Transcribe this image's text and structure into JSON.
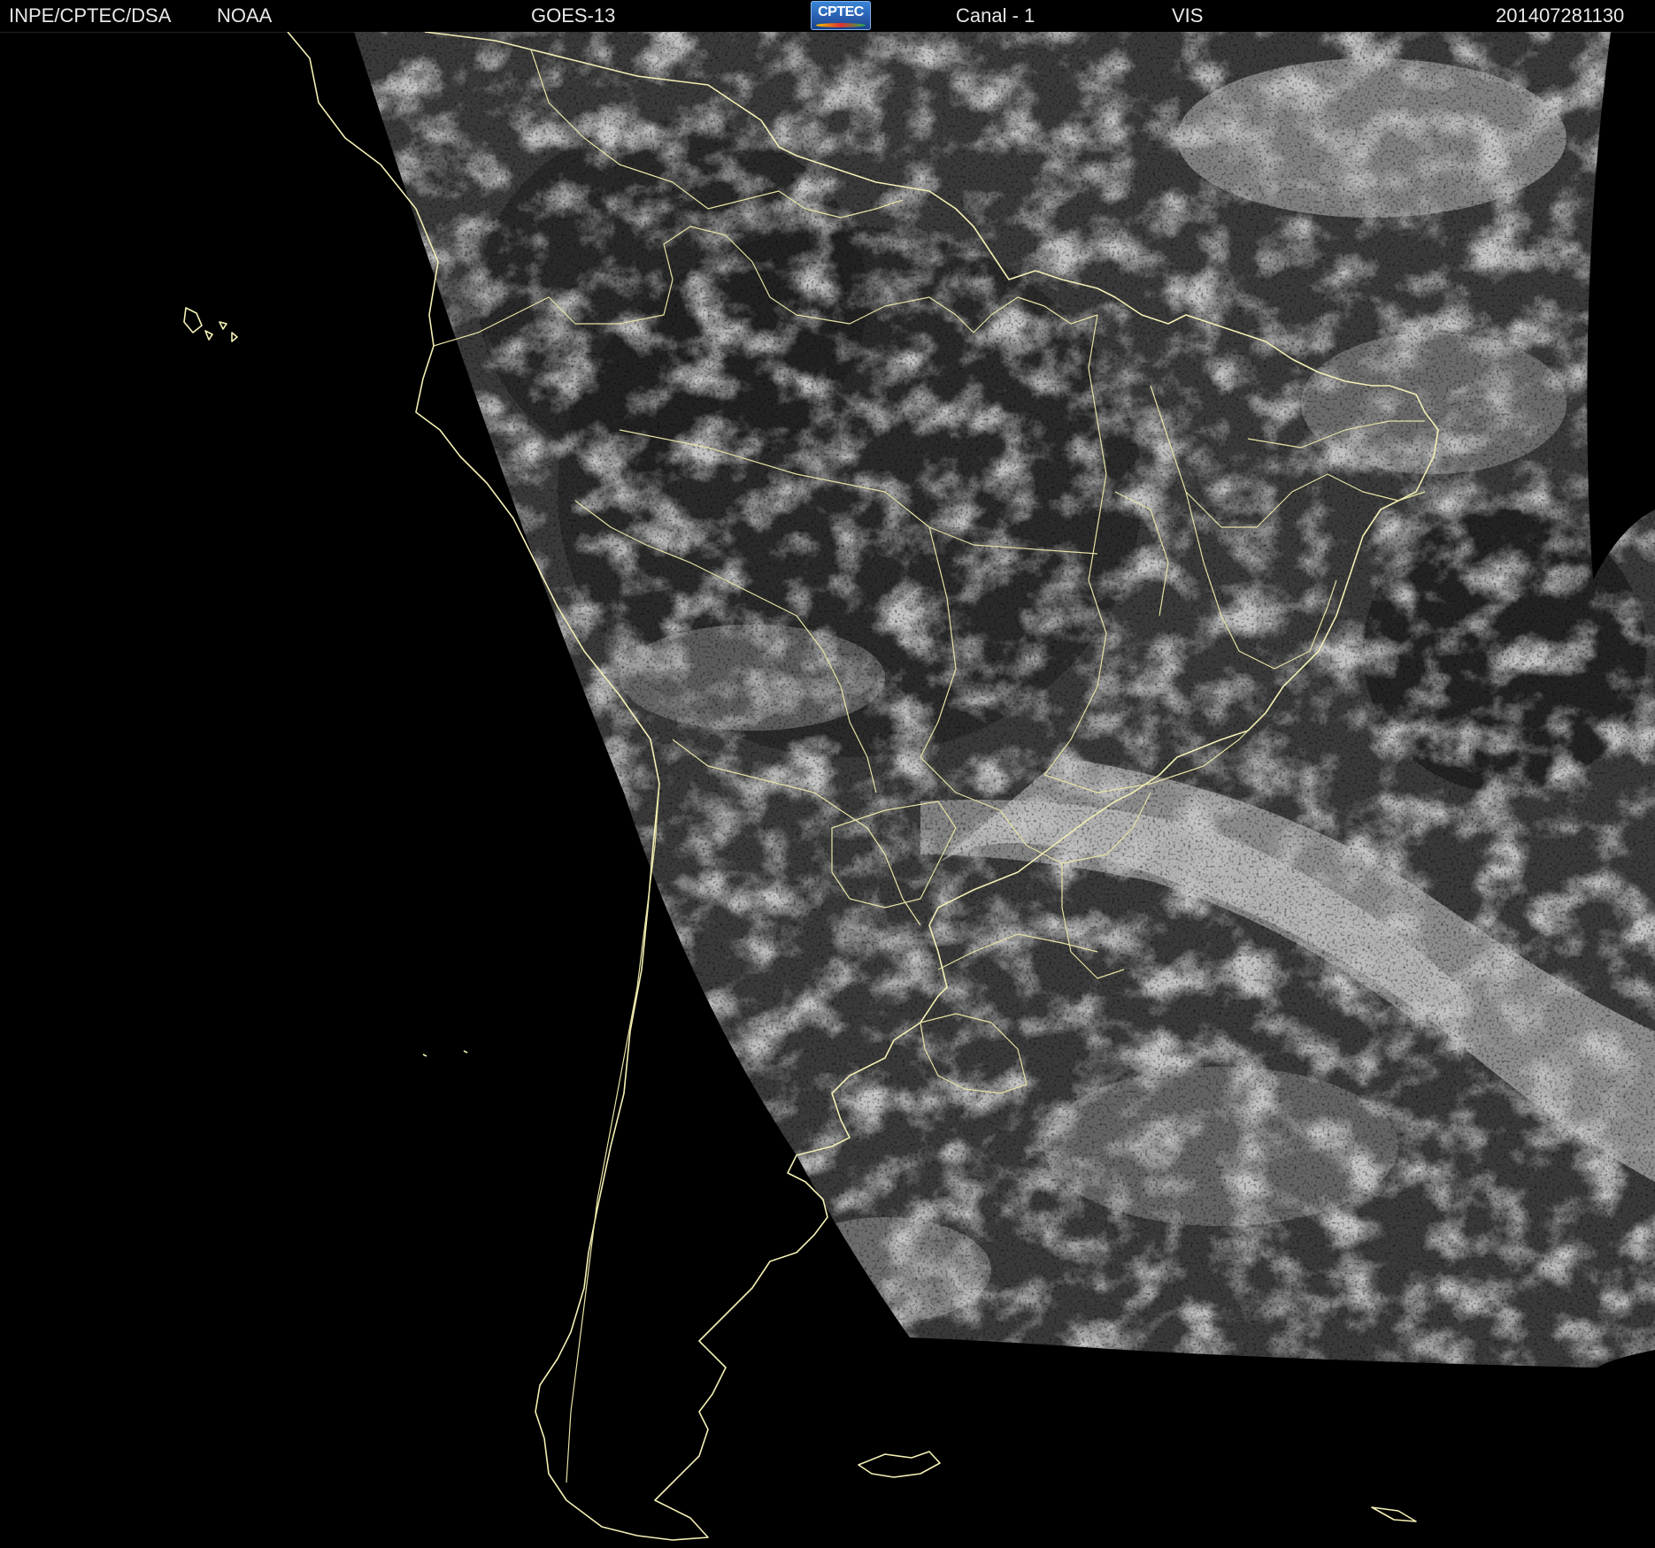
{
  "header": {
    "agency": "INPE/CPTEC/DSA",
    "source": "NOAA",
    "satellite": "GOES-13",
    "logo_text": "CPTEC",
    "channel": "Canal - 1",
    "band": "VIS",
    "datetime": "201407281130"
  },
  "map": {
    "coastline_color": "#f4f0b5",
    "border_color": "#e7e3a4",
    "background_color": "#000000",
    "land_tone": "#3a3a3a",
    "cloud_tone": "#d8d8d8"
  }
}
